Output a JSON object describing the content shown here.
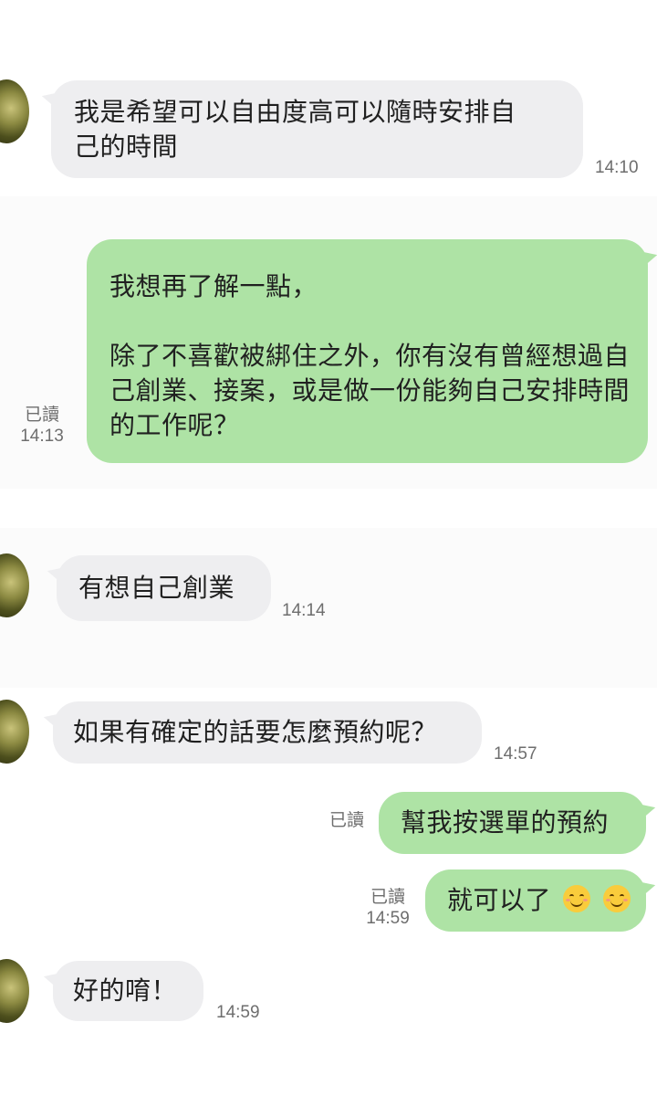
{
  "messages": [
    {
      "side": "in",
      "lines": [
        "我是希望可以自由度高可以隨時安排自",
        "己的時間"
      ],
      "time": "14:10"
    },
    {
      "side": "out",
      "lines": [
        "我想再了解一點，",
        "",
        "除了不喜歡被綁住之外，你有沒有曾經想過自",
        "己創業、接案，或是做一份能夠自己安排時間",
        "的工作呢？"
      ],
      "read": "已讀",
      "time": "14:13"
    },
    {
      "side": "in",
      "text": "有想自己創業",
      "time": "14:14"
    },
    {
      "side": "in",
      "text": "如果有確定的話要怎麼預約呢？",
      "time": "14:57"
    },
    {
      "side": "out",
      "text": "幫我按選單的預約",
      "read": "已讀"
    },
    {
      "side": "out",
      "text": "就可以了",
      "emojis": [
        "smiling-face-icon",
        "smiling-face-icon"
      ],
      "read": "已讀",
      "time": "14:59"
    },
    {
      "side": "in",
      "text": "好的唷！",
      "time": "14:59"
    }
  ]
}
